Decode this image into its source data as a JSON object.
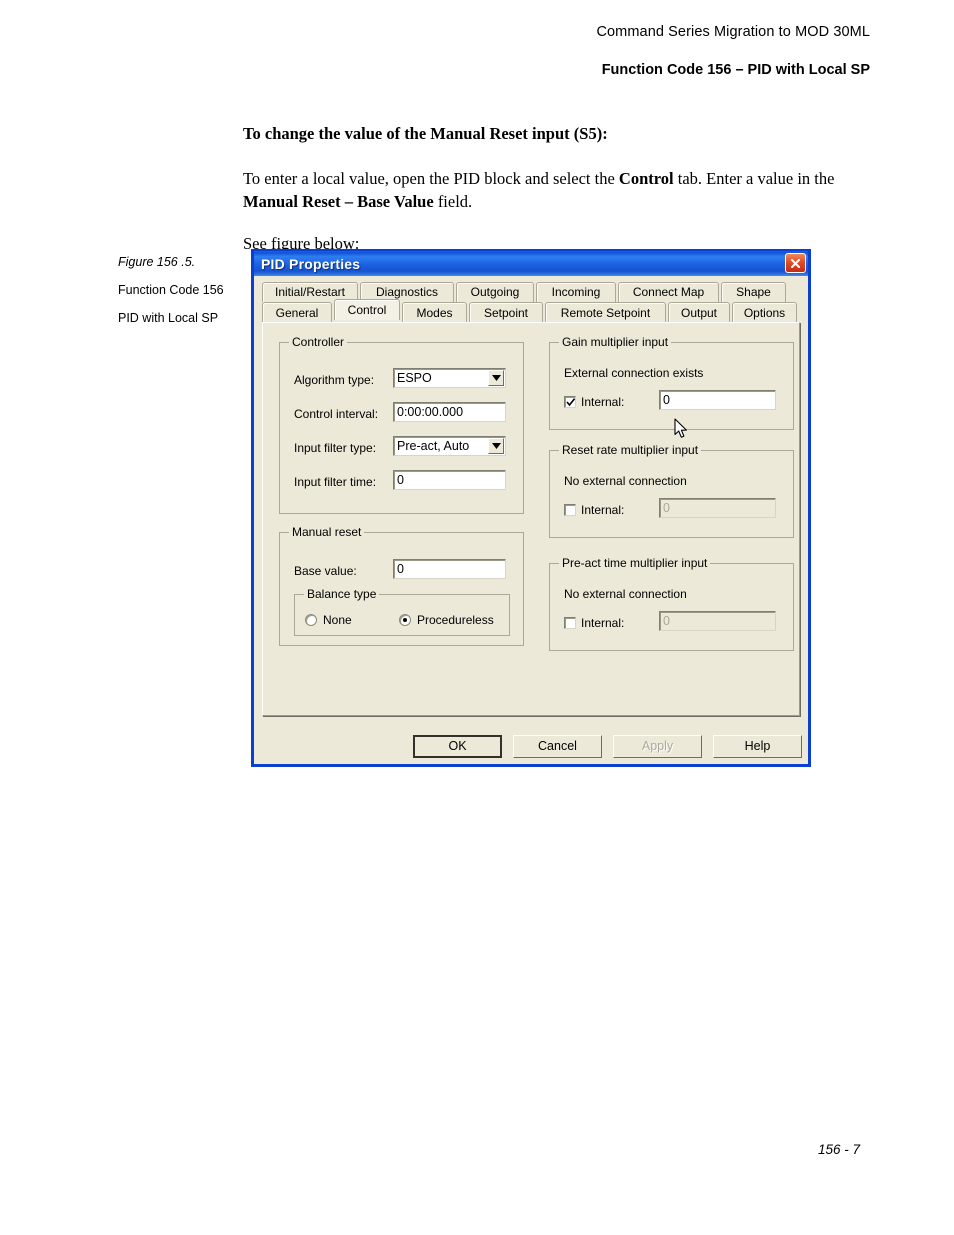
{
  "page": {
    "header_line1": "Command Series Migration to MOD 30ML",
    "header_line2": "Function Code 156 – PID with Local SP",
    "footer": "156 - 7"
  },
  "body": {
    "lead": "To change the value of the Manual Reset input (S5):",
    "para2_part1": "To enter a local value, open the PID block and select the ",
    "para2_bold1": "Control",
    "para2_part2": " tab. Enter a value in the ",
    "para2_bold2": "Manual Reset – Base Value",
    "para2_part3": " field.",
    "para3": "See figure below:"
  },
  "figure_caption": {
    "number": "Figure 156 .5.",
    "line1": "Function Code 156",
    "line2": "PID with Local SP"
  },
  "dialog": {
    "title": "PID Properties",
    "close_label": "close-icon",
    "tabs_row1": [
      {
        "label": "Initial/Restart",
        "active": false
      },
      {
        "label": "Diagnostics",
        "active": false
      },
      {
        "label": "Outgoing",
        "active": false
      },
      {
        "label": "Incoming",
        "active": false
      },
      {
        "label": "Connect Map",
        "active": false
      },
      {
        "label": "Shape",
        "active": false
      }
    ],
    "tabs_row2": [
      {
        "label": "General",
        "active": false
      },
      {
        "label": "Control",
        "active": true
      },
      {
        "label": "Modes",
        "active": false
      },
      {
        "label": "Setpoint",
        "active": false
      },
      {
        "label": "Remote Setpoint",
        "active": false
      },
      {
        "label": "Output",
        "active": false
      },
      {
        "label": "Options",
        "active": false
      }
    ],
    "controller": {
      "legend": "Controller",
      "algorithm_type_label": "Algorithm type:",
      "algorithm_type_value": "ESPO",
      "control_interval_label": "Control interval:",
      "control_interval_value": "0:00:00.000",
      "input_filter_type_label": "Input filter type:",
      "input_filter_type_value": "Pre-act, Auto",
      "input_filter_time_label": "Input filter time:",
      "input_filter_time_value": "0"
    },
    "manual_reset": {
      "legend": "Manual reset",
      "base_value_label": "Base value:",
      "base_value": "0",
      "balance_type": {
        "legend": "Balance type",
        "options": [
          {
            "label": "None",
            "selected": false
          },
          {
            "label": "Procedureless",
            "selected": true
          }
        ]
      }
    },
    "gain_multiplier": {
      "legend": "Gain multiplier input",
      "connection_status": "External connection exists",
      "internal_label": "Internal:",
      "internal_checked": true,
      "internal_value": "0",
      "internal_disabled": false
    },
    "reset_rate_multiplier": {
      "legend": "Reset rate multiplier input",
      "connection_status": "No external connection",
      "internal_label": "Internal:",
      "internal_checked": false,
      "internal_value": "0",
      "internal_disabled": true
    },
    "preact_time_multiplier": {
      "legend": "Pre-act time multiplier input",
      "connection_status": "No external connection",
      "internal_label": "Internal:",
      "internal_checked": false,
      "internal_value": "0",
      "internal_disabled": true
    },
    "buttons": [
      {
        "label": "OK",
        "style": "default"
      },
      {
        "label": "Cancel",
        "style": "normal"
      },
      {
        "label": "Apply",
        "style": "disabled"
      },
      {
        "label": "Help",
        "style": "normal"
      }
    ]
  },
  "colors": {
    "title_bar_blue": "#1c63e4",
    "dialog_face": "#ece9d8",
    "close_red": "#d8391a",
    "frame_blue": "#0a3fd1"
  }
}
